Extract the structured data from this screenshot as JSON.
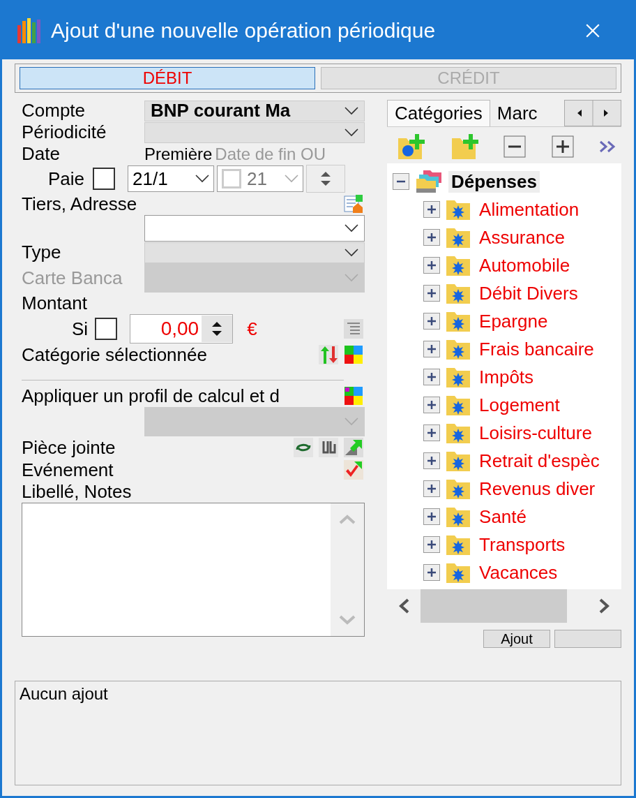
{
  "window": {
    "title": "Ajout d'une nouvelle opération périodique"
  },
  "type_tabs": [
    {
      "label": "DÉBIT",
      "selected": true
    },
    {
      "label": "CRÉDIT",
      "selected": false
    }
  ],
  "form": {
    "account": {
      "label": "Compte",
      "value": "BNP courant Ma"
    },
    "periodicity": {
      "label": "Périodicité"
    },
    "date": {
      "label": "Date",
      "first_label": "Première",
      "end_label": "Date de fin OU",
      "pay_label": "Paie",
      "pay_checked": false,
      "first_value": "21/1",
      "end_checked": false,
      "end_value": "21"
    },
    "payee": {
      "label": "Tiers, Adresse"
    },
    "type": {
      "label": "Type"
    },
    "card": {
      "label": "Carte Banca",
      "disabled": true
    },
    "amount": {
      "label": "Montant",
      "si_label": "Si",
      "si_checked": false,
      "value": "0,00",
      "currency": "€"
    },
    "category": {
      "label": "Catégorie sélectionnée"
    },
    "profile": {
      "label": "Appliquer un profil de calcul et d",
      "disabled": true
    },
    "attachment": {
      "label": "Pièce jointe"
    },
    "event": {
      "label": "Evénement"
    },
    "notes": {
      "label": "Libellé, Notes"
    },
    "buttons": [
      "Ajout"
    ]
  },
  "side_tabs": [
    {
      "label": "Catégories",
      "selected": true
    },
    {
      "label": "Marc",
      "selected": false
    }
  ],
  "tree": {
    "label": "Dépenses",
    "expanded": true,
    "selected": true,
    "children": [
      {
        "label": "Alimentation",
        "expanded": false,
        "selected": false
      },
      {
        "label": "Assurance",
        "expanded": false,
        "selected": false
      },
      {
        "label": "Automobile",
        "expanded": false,
        "selected": false
      },
      {
        "label": "Débit Divers",
        "expanded": false,
        "selected": false
      },
      {
        "label": "Epargne",
        "expanded": false,
        "selected": false
      },
      {
        "label": "Frais bancaire",
        "expanded": false,
        "selected": false
      },
      {
        "label": "Impôts",
        "expanded": false,
        "selected": false
      },
      {
        "label": "Logement",
        "expanded": false,
        "selected": false
      },
      {
        "label": "Loisirs-culture",
        "expanded": false,
        "selected": false
      },
      {
        "label": "Retrait d'espèc",
        "expanded": false,
        "selected": false
      },
      {
        "label": "Revenus diver",
        "expanded": false,
        "selected": false
      },
      {
        "label": "Santé",
        "expanded": false,
        "selected": false
      },
      {
        "label": "Transports",
        "expanded": false,
        "selected": false
      },
      {
        "label": "Vacances",
        "expanded": false,
        "selected": false
      }
    ]
  },
  "status": {
    "text": "Aucun ajout"
  }
}
